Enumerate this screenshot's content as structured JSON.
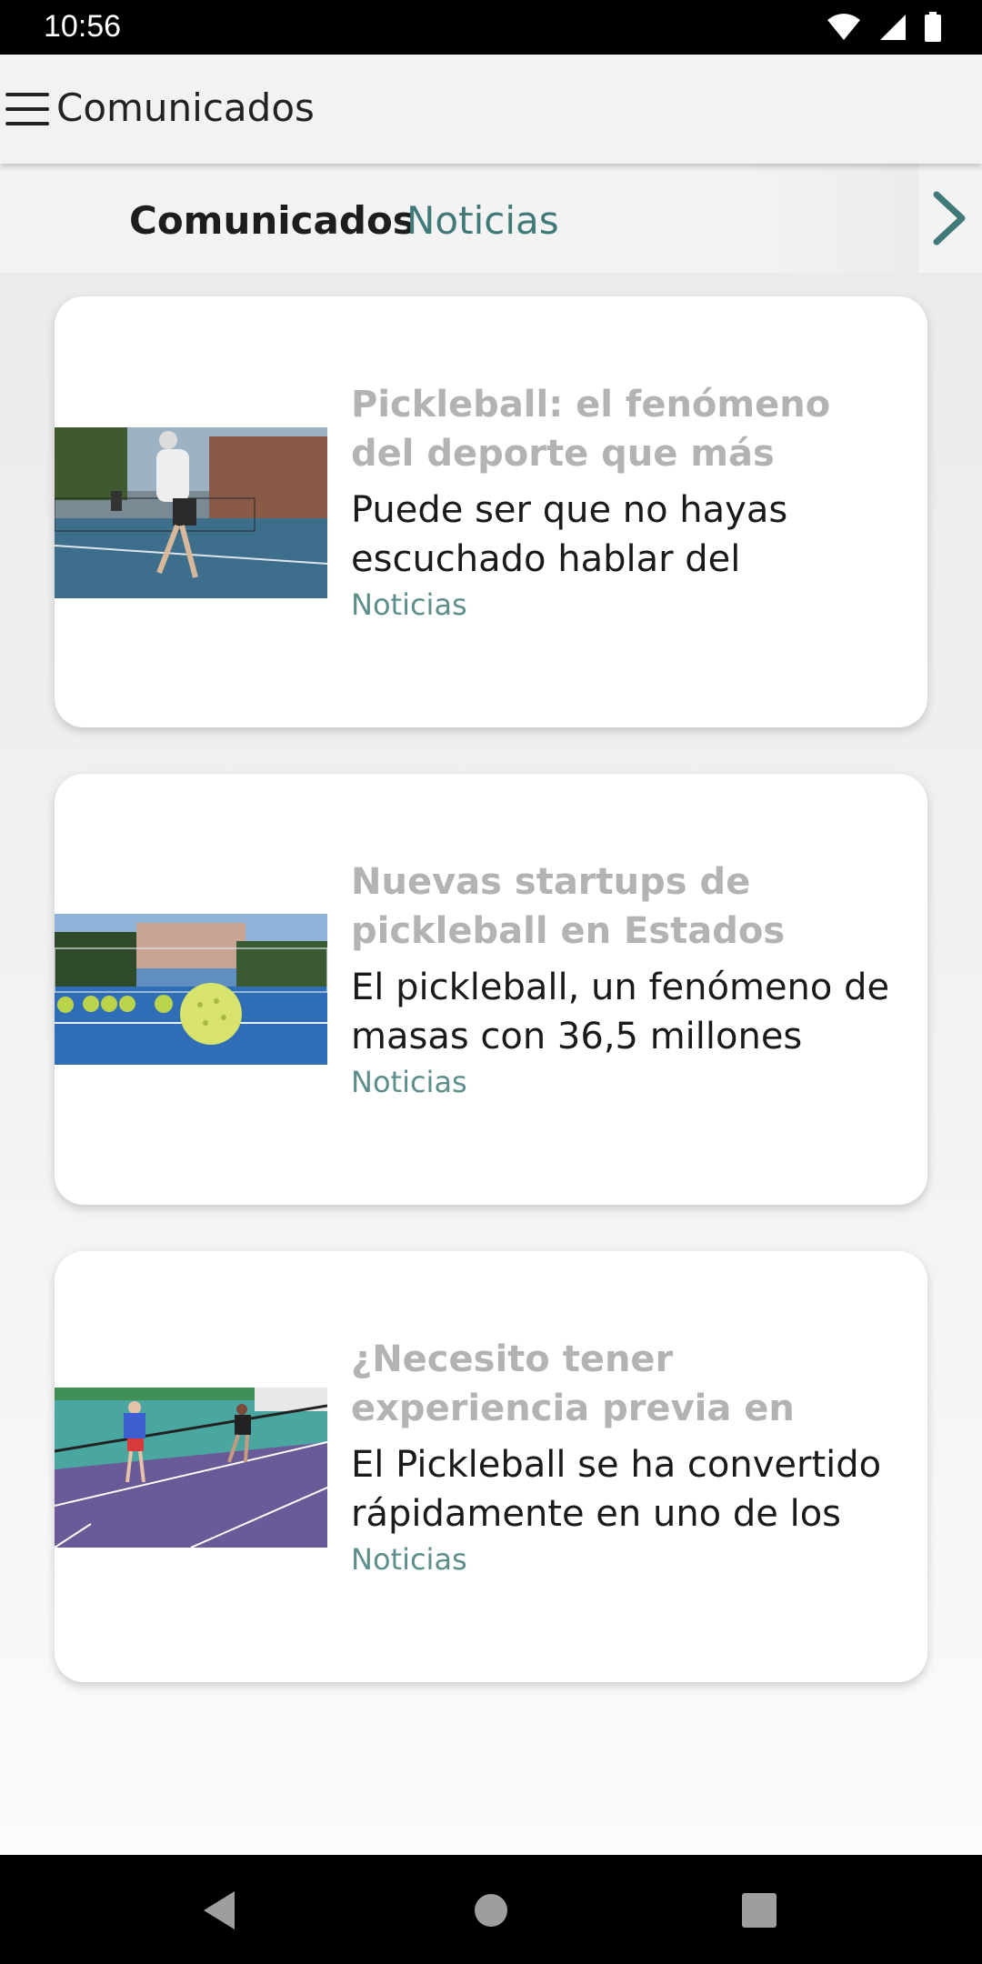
{
  "status_bar": {
    "time": "10:56"
  },
  "app_bar": {
    "title": "Comunicados"
  },
  "tabs": [
    {
      "label": "Comunicados",
      "active": true
    },
    {
      "label": "Noticias",
      "active": false
    }
  ],
  "cards": [
    {
      "title": "Pickleball: el fenómeno del deporte que más crece en",
      "excerpt": "Puede ser que no hayas escuchado hablar del",
      "category": "Noticias",
      "image": "pickleball-player-court"
    },
    {
      "title": "Nuevas startups de pickleball en Estados Unidos",
      "excerpt": "El pickleball, un fenómeno de masas con 36,5 millones",
      "category": "Noticias",
      "image": "pickleball-balls-court"
    },
    {
      "title": "¿Necesito tener experiencia previa en otros deportes para",
      "excerpt": "El Pickleball se ha convertido rápidamente en uno de los",
      "category": "Noticias",
      "image": "pickleball-doubles-court"
    }
  ],
  "colors": {
    "accent": "#3f7a78",
    "category": "#5c8f8c",
    "title_muted": "#b3b3b3"
  }
}
